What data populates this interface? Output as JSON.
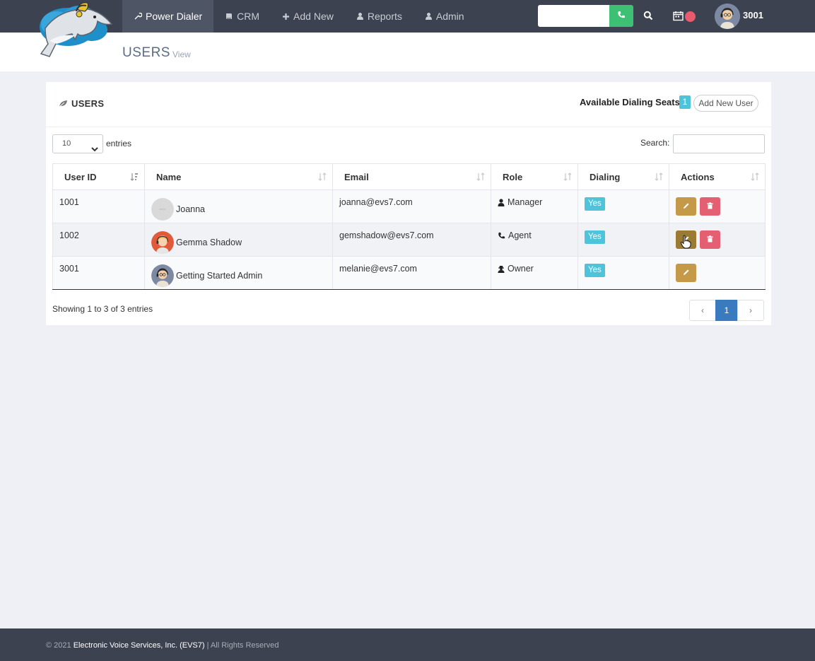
{
  "nav": {
    "items": [
      {
        "label": "Power Dialer",
        "icon": "wrench-icon",
        "active": true
      },
      {
        "label": "CRM",
        "icon": "book-icon",
        "active": false
      },
      {
        "label": "Add New",
        "icon": "plus-icon",
        "active": false
      },
      {
        "label": "Reports",
        "icon": "user-secret-icon",
        "active": false
      },
      {
        "label": "Admin",
        "icon": "user-secret-icon",
        "active": false
      }
    ],
    "user_name": "3001"
  },
  "header": {
    "title": "USERS",
    "subtitle": "View"
  },
  "card": {
    "title": "USERS",
    "seats_label": "Available Dialing Seats:",
    "seats_count": "1",
    "add_user_label": "Add New User"
  },
  "controls": {
    "entries_value": "10",
    "entries_label": "entries",
    "search_label": "Search:"
  },
  "table": {
    "columns": [
      "User ID",
      "Name",
      "Email",
      "Role",
      "Dialing",
      "Actions"
    ],
    "rows": [
      {
        "id": "1001",
        "name": "Joanna",
        "email": "joanna@evs7.com",
        "role": "Manager",
        "role_icon": "user-icon",
        "dialing": "Yes",
        "can_delete": true
      },
      {
        "id": "1002",
        "name": "Gemma Shadow",
        "email": "gemshadow@evs7.com",
        "role": "Agent",
        "role_icon": "phone-icon",
        "dialing": "Yes",
        "can_delete": true
      },
      {
        "id": "3001",
        "name": "Getting Started Admin",
        "email": "melanie@evs7.com",
        "role": "Owner",
        "role_icon": "user-secret-icon",
        "dialing": "Yes",
        "can_delete": false
      }
    ]
  },
  "pagination": {
    "showing": "Showing 1 to 3 of 3 entries",
    "prev": "‹",
    "current": "1",
    "next": "›"
  },
  "footer": {
    "prefix": "© 2021",
    "company": "Electronic Voice Services, Inc. (EVS7)",
    "suffix": "| All Rights Reserved"
  },
  "colors": {
    "topbar": "#3c4250",
    "call_green": "#3dbf74",
    "badge_cyan": "#4fc3d9",
    "edit_gold": "#c49a48",
    "delete_red": "#e55f72",
    "page_active_blue": "#3a7bbf"
  }
}
